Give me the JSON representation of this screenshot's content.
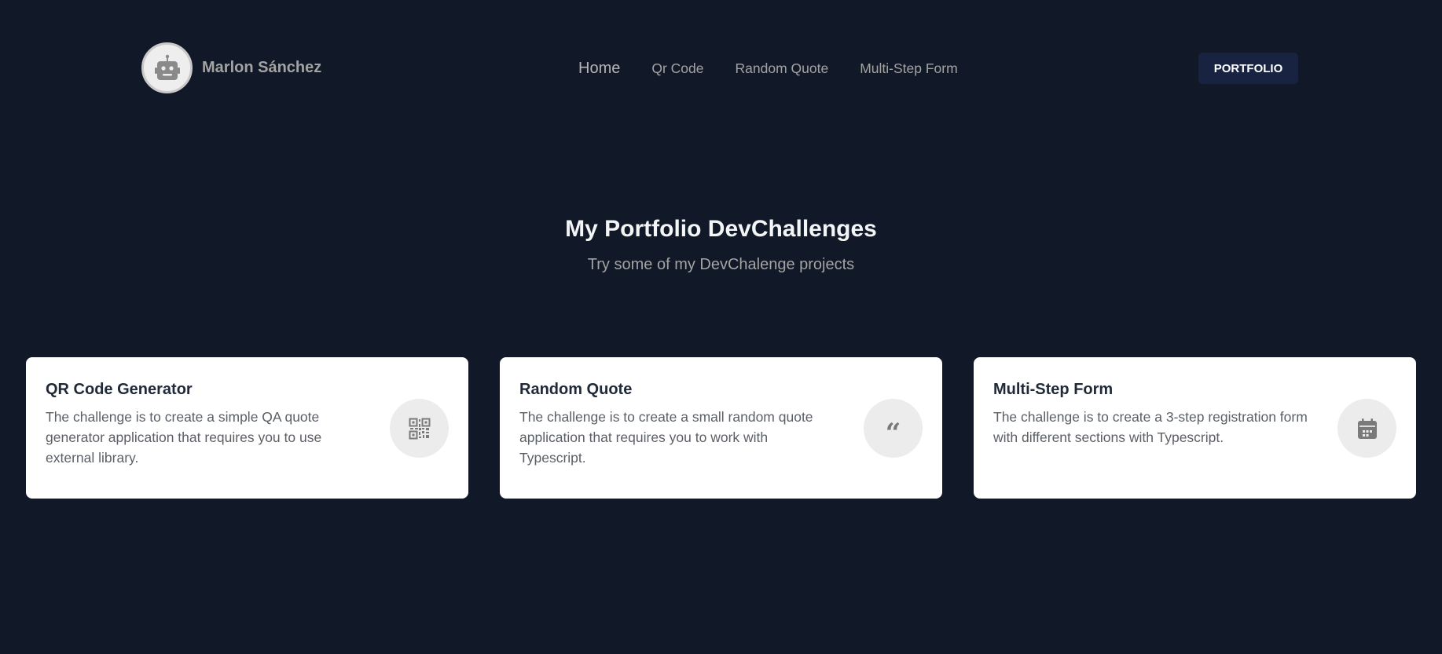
{
  "header": {
    "brand_name": "Marlon Sánchez",
    "avatar_icon": "robot-icon",
    "nav": [
      {
        "label": "Home"
      },
      {
        "label": "Qr Code"
      },
      {
        "label": "Random Quote"
      },
      {
        "label": "Multi-Step Form"
      }
    ],
    "portfolio_button": "PORTFOLIO"
  },
  "hero": {
    "title": "My Portfolio DevChallenges",
    "subtitle": "Try some of my DevChalenge projects"
  },
  "cards": [
    {
      "title": "QR Code Generator",
      "description": "The challenge is to create a simple QA quote generator application that requires you to use external library.",
      "icon": "qr-code-icon"
    },
    {
      "title": "Random Quote",
      "description": "The challenge is to create a small random quote application that requires you to work with Typescript.",
      "icon": "quote-icon"
    },
    {
      "title": "Multi-Step Form",
      "description": "The challenge is to create a 3-step registration form with different sections with Typescript.",
      "icon": "calendar-icon"
    }
  ],
  "colors": {
    "background": "#111827",
    "card_background": "#ffffff",
    "button_background": "#172341",
    "muted_text": "#a3a3a3"
  }
}
